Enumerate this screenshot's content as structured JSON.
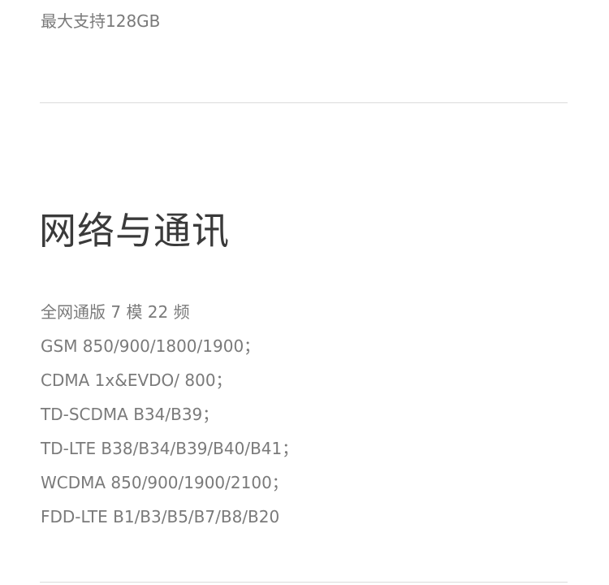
{
  "storage": {
    "note": "最大支持128GB"
  },
  "network": {
    "title": "网络与通讯",
    "specs": [
      "全网通版 7 模 22 频",
      "GSM 850/900/1800/1900；",
      "CDMA 1x&EVDO/ 800；",
      "TD-SCDMA B34/B39；",
      "TD-LTE B38/B34/B39/B40/B41；",
      "WCDMA 850/900/1900/2100；",
      "FDD-LTE B1/B3/B5/B7/B8/B20"
    ]
  },
  "colors": {
    "body_text": "#7a7a7a",
    "title_text": "#3a3a3a",
    "divider": "#dcdcdc",
    "background": "#ffffff"
  }
}
